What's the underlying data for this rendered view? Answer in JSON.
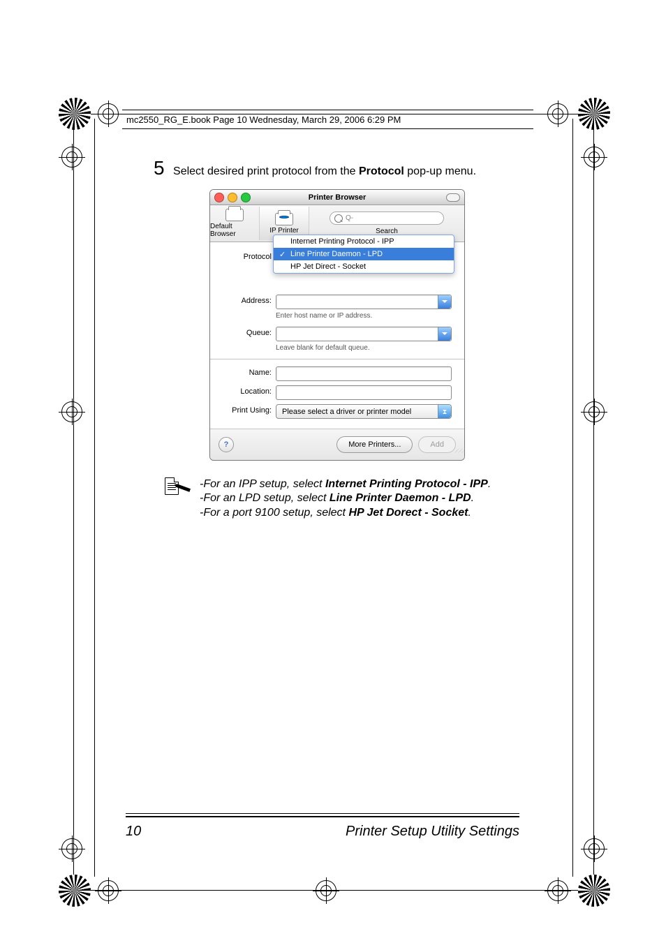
{
  "print_header": "mc2550_RG_E.book  Page 10  Wednesday, March 29, 2006  6:29 PM",
  "step": {
    "num": "5",
    "before": "Select desired print protocol from the ",
    "bold": "Protocol",
    "after": " pop-up menu."
  },
  "mac": {
    "title": "Printer Browser",
    "toolbar": {
      "default_browser": "Default Browser",
      "ip_printer": "IP Printer",
      "search_label": "Search",
      "search_placeholder": "Q-"
    },
    "labels": {
      "protocol": "Protocol",
      "address": "Address:",
      "queue": "Queue:",
      "name": "Name:",
      "location": "Location:",
      "print_using": "Print Using:"
    },
    "protocol_menu": {
      "items": [
        "Internet Printing Protocol - IPP",
        "Line Printer Daemon - LPD",
        "HP Jet Direct - Socket"
      ],
      "selected": "Line Printer Daemon - LPD"
    },
    "hints": {
      "address": "Enter host name or IP address.",
      "queue": "Leave blank for default queue."
    },
    "print_using_value": "Please select a driver or printer model",
    "buttons": {
      "more": "More Printers...",
      "add": "Add"
    }
  },
  "note": {
    "l1_a": "-For an IPP setup, select ",
    "l1_b": "Internet Printing Protocol - IPP",
    "l1_c": ".",
    "l2_a": "-For an LPD setup, select ",
    "l2_b": "Line Printer Daemon - LPD",
    "l2_c": ".",
    "l3_a": "-For a port 9100 setup, select ",
    "l3_b": "HP Jet Dorect - Socket",
    "l3_c": "."
  },
  "footer": {
    "page_num": "10",
    "page_title": "Printer Setup Utility Settings"
  }
}
